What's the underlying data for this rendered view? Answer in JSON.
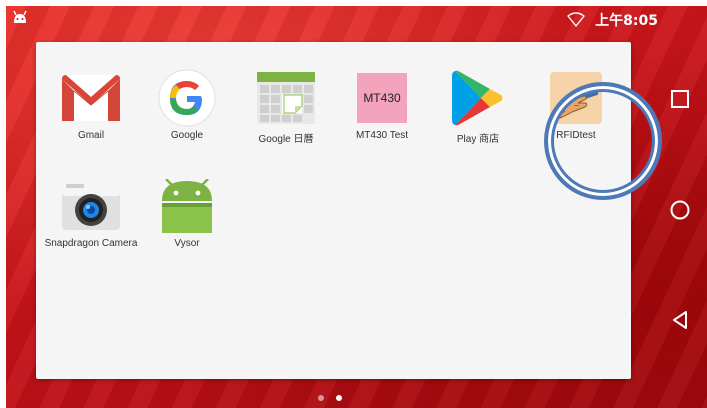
{
  "status_bar": {
    "time": "上午8:05",
    "left_icon": "android-head-icon",
    "wifi_icon": "wifi-icon"
  },
  "apps": [
    {
      "label": "Gmail",
      "icon": "gmail-icon"
    },
    {
      "label": "Google",
      "icon": "google-icon"
    },
    {
      "label": "Google 日曆",
      "icon": "google-calendar-icon"
    },
    {
      "label": "MT430 Test",
      "icon": "mt430-icon",
      "icon_text": "MT430"
    },
    {
      "label": "Play 商店",
      "icon": "play-store-icon"
    },
    {
      "label": "RFIDtest",
      "icon": "rfid-icon"
    },
    {
      "label": "Snapdragon Camera",
      "icon": "camera-icon"
    },
    {
      "label": "Vysor",
      "icon": "android-icon"
    }
  ],
  "nav": [
    "recents-icon",
    "home-icon",
    "back-icon"
  ],
  "page_indicator": {
    "pages": 2,
    "active": 2
  },
  "colors": {
    "accent_ring": "#4e79b7",
    "background": "#c8141a"
  }
}
